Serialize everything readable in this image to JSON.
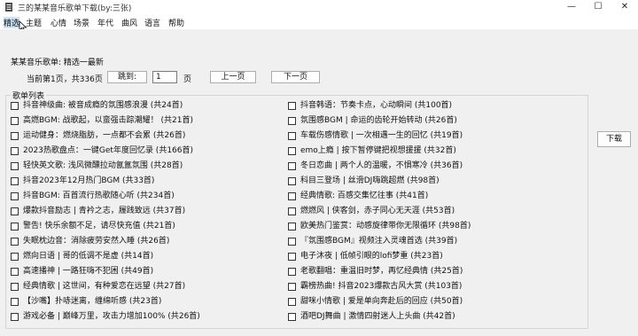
{
  "window": {
    "title": "三的某某音乐歌单下载(by:三张)",
    "minimize": "—",
    "maximize": "☐",
    "close": "✕"
  },
  "menu": [
    "精选",
    "主题",
    "心情",
    "场景",
    "年代",
    "曲风",
    "语言",
    "帮助"
  ],
  "header": {
    "playlist_label": "某某音乐歌单: 精选一最新",
    "page_info": "当前第1页，共336页",
    "jump_label": "跳到:",
    "page_input": "1",
    "page_unit": "页",
    "prev_label": "上一页",
    "next_label": "下一页"
  },
  "list_title": "歌单列表",
  "download_label": "下载",
  "songs_left": [
    "抖音神级曲: 被音成瘾的氛围感浪漫 (共24首)",
    "高燃BGM: 战歌起，以蛮强击踪潮耀！ (共21首)",
    "运动健身：燃烧脂肪，一点都不会累 (共26首)",
    "2023热歌盘点：一键Get年度回忆录 (共166首)",
    "轻快英文歌: 浅风微醺拉动氤氲氛围 (共28首)",
    "抖音2023年12月热门BGM (共33首)",
    "抖音BGM: 百首流行热歌随心听 (共234首)",
    "爆款抖音励志 | 青衿之志，履践致远 (共37首)",
    "警告! 快乐余额不足，请尽快充值 (共21首)",
    "失眠枕边音：消除疲劳安然入睡 (共26首)",
    "燃向日语 | 哥的低调不是虚 (共14首)",
    "高速播神 | 一路狂嗨不犯困 (共49首)",
    "经典情歌 | 这世间，有种爱恋在远望 (共27首)",
    "【沙嘴】扑哧迷离，缠绵听感 (共23首)",
    "游戏必备 | 巅峰万里，攻击力增加100% (共26首)"
  ],
  "songs_right": [
    "抖音韩语：节奏卡点，心动瞬间 (共100首)",
    "氛围感BGM | 命运的齿轮开始转动 (共26首)",
    "车载伤感情歌 | 一次相遇一生的回忆 (共19首)",
    "emo上瘾 | 按下暂停键把视想援援 (共32首)",
    "冬日恋曲 | 两个人的温暖，不惧寒冷 (共36首)",
    "科目三登场 | 丝滑DJ嗨跳超燃 (共98首)",
    "经典情歌: 百感交集忆往事 (共41首)",
    "燃燃风 | 侠客剑，赤子同心无天涯 (共53首)",
    "欧美热门鉴赏：动感旋律带你无限循环 (共98首)",
    "『氛围感BGM』视频注入灵魂首选 (共39首)",
    "电子沐夜 | 低帧引眼的lofi梦重 (共23首)",
    "老歌翻唱：重温旧时梦，再忆经典情 (共25首)",
    "霸榜热曲! 抖音2023爆款古风大赏 (共103首)",
    "甜咪小情歌 | 爱是单向奔赴后的回应 (共50首)",
    "酒吧DJ舞曲 | 激情四射迷人上头曲 (共42首)"
  ]
}
